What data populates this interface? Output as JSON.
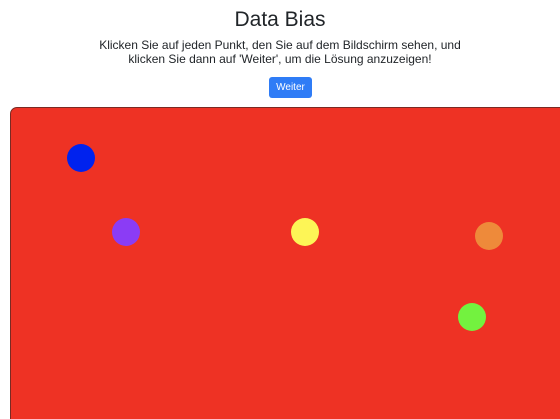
{
  "header": {
    "title": "Data Bias",
    "instructions": "Klicken Sie auf jeden Punkt, den Sie auf dem Bildschirm sehen, und klicken Sie dann auf 'Weiter', um die Lösung anzuzeigen!"
  },
  "controls": {
    "next_label": "Weiter"
  },
  "canvas": {
    "background_color": "#ee3224",
    "dots": [
      {
        "name": "dot-blue",
        "color": "#0022ee"
      },
      {
        "name": "dot-purple",
        "color": "#8b3cf5"
      },
      {
        "name": "dot-yellow",
        "color": "#fdf556"
      },
      {
        "name": "dot-orange",
        "color": "#ee8a3a"
      },
      {
        "name": "dot-green",
        "color": "#73f23f"
      }
    ]
  }
}
